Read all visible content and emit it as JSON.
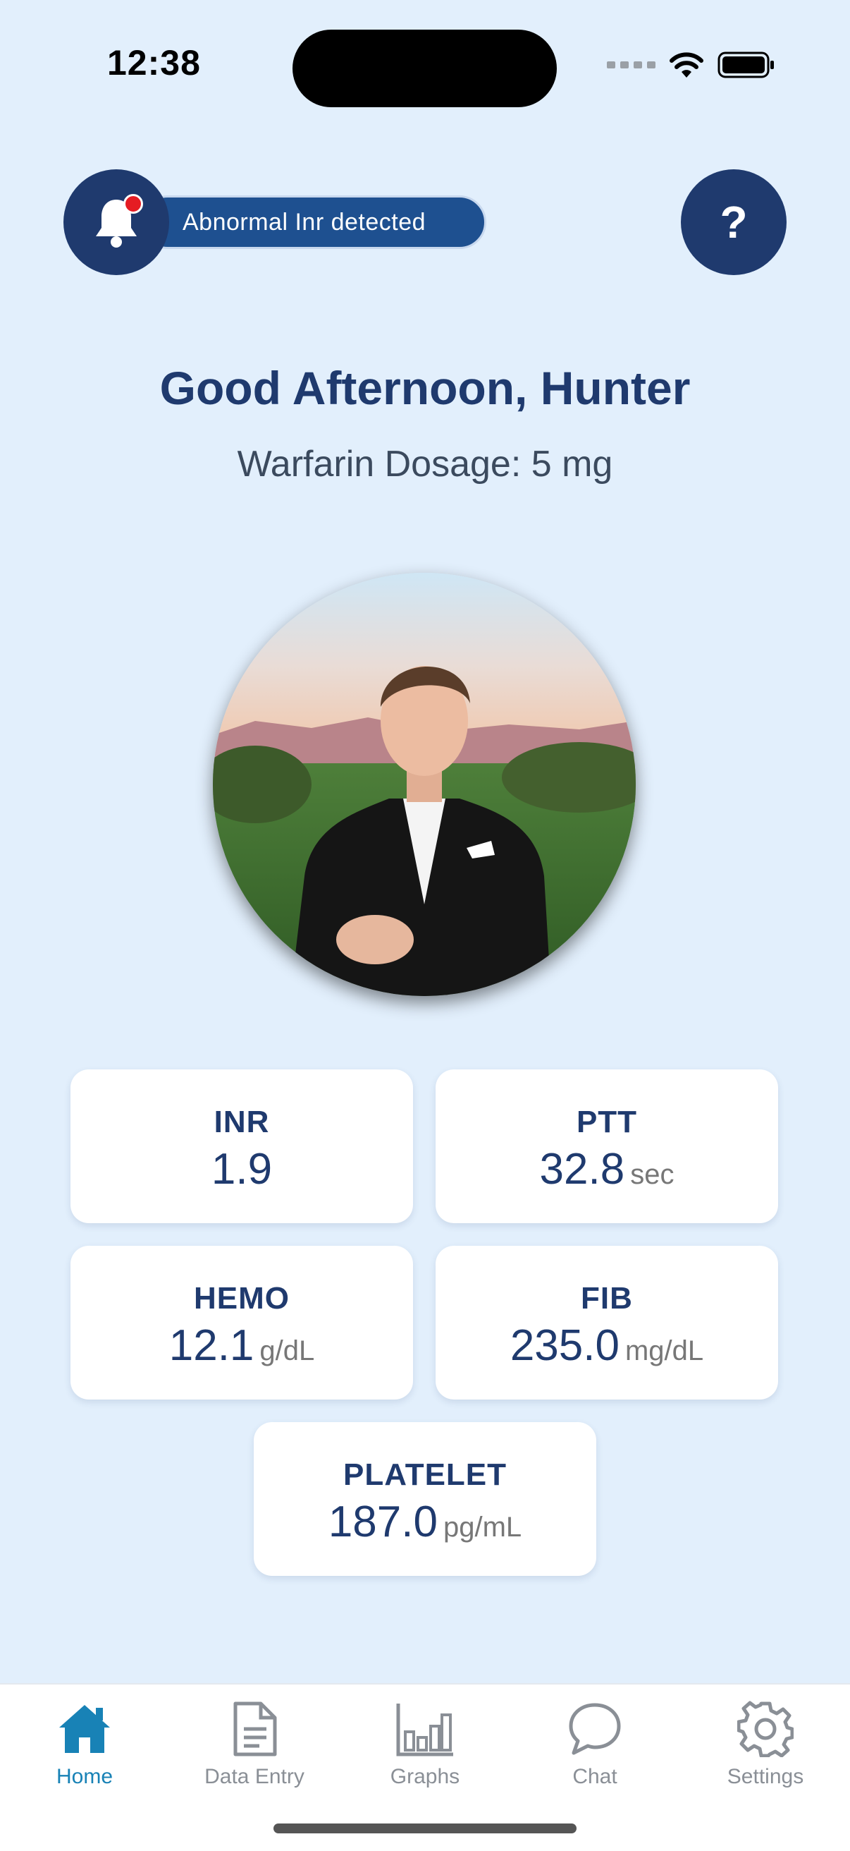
{
  "status": {
    "time": "12:38"
  },
  "alert": {
    "text": "Abnormal Inr detected"
  },
  "help": {
    "label": "?"
  },
  "greeting": "Good Afternoon, Hunter",
  "dosage": "Warfarin Dosage: 5 mg",
  "metrics": [
    {
      "label": "INR",
      "value": "1.9",
      "unit": ""
    },
    {
      "label": "PTT",
      "value": "32.8",
      "unit": "sec"
    },
    {
      "label": "HEMO",
      "value": "12.1",
      "unit": "g/dL"
    },
    {
      "label": "FIB",
      "value": "235.0",
      "unit": "mg/dL"
    },
    {
      "label": "PLATELET",
      "value": "187.0",
      "unit": "pg/mL"
    }
  ],
  "tabs": [
    {
      "label": "Home",
      "icon": "home-icon",
      "active": true
    },
    {
      "label": "Data Entry",
      "icon": "document-icon",
      "active": false
    },
    {
      "label": "Graphs",
      "icon": "bar-chart-icon",
      "active": false
    },
    {
      "label": "Chat",
      "icon": "chat-bubble-icon",
      "active": false
    },
    {
      "label": "Settings",
      "icon": "gear-icon",
      "active": false
    }
  ],
  "colors": {
    "background": "#e2effc",
    "navy": "#1f3a6e",
    "alert_pill": "#1e5090",
    "active_tab": "#1882b6",
    "alert_dot": "#e51c23"
  }
}
